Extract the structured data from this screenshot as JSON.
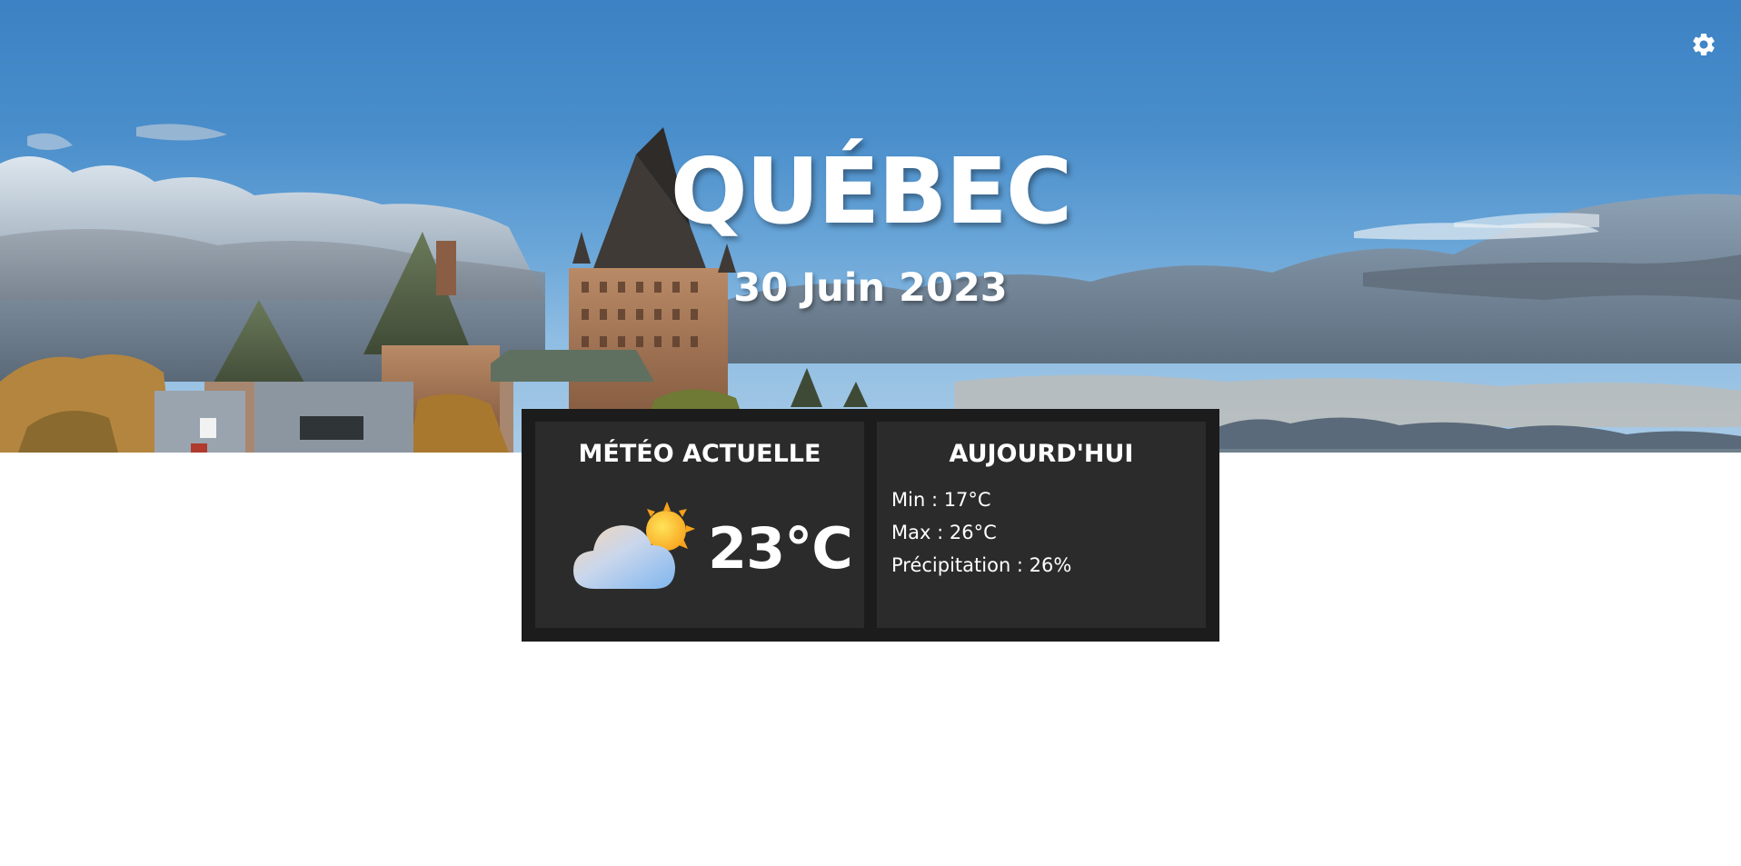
{
  "header": {
    "city": "QUÉBEC",
    "date": "30 Juin 2023"
  },
  "settings": {
    "icon": "gear-icon",
    "color": "#ffffff"
  },
  "current": {
    "title": "MÉTÉO ACTUELLE",
    "temperature": "23°C",
    "condition_icon": "partly-cloudy-icon"
  },
  "today": {
    "title": "AUJOURD'HUI",
    "min": "Min : 17°C",
    "max": "Max : 26°C",
    "precipitation": "Précipitation : 26%"
  },
  "colors": {
    "panel_bg": "#1c1c1c",
    "card_bg": "#2b2b2b",
    "text": "#ffffff",
    "sky": "#3c82c4"
  }
}
